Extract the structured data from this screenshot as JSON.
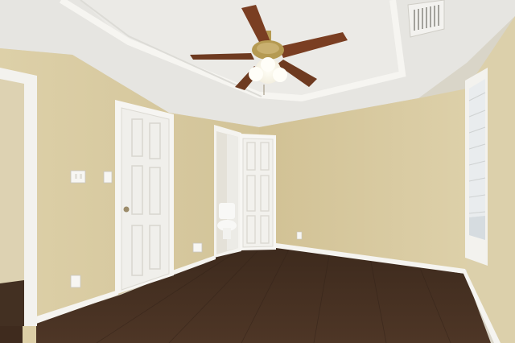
{
  "scene": {
    "description_kind": "empty bedroom interior photo",
    "colors": {
      "wall": "#d8c9a0",
      "wall_shadow": "#c9b98c",
      "ceiling": "#e8e7e3",
      "trim": "#f4f3ef",
      "floor": "#4a3424",
      "door": "#f1f0ec",
      "fan_blade": "#7a3e22",
      "fan_brass": "#b59a52",
      "light_glow": "#fffbe8"
    },
    "icons": [
      "ceiling-fan-icon",
      "air-vent-icon",
      "light-switch-icon",
      "outlet-icon",
      "toilet-icon",
      "door-knob-icon",
      "window-blinds-icon"
    ]
  }
}
